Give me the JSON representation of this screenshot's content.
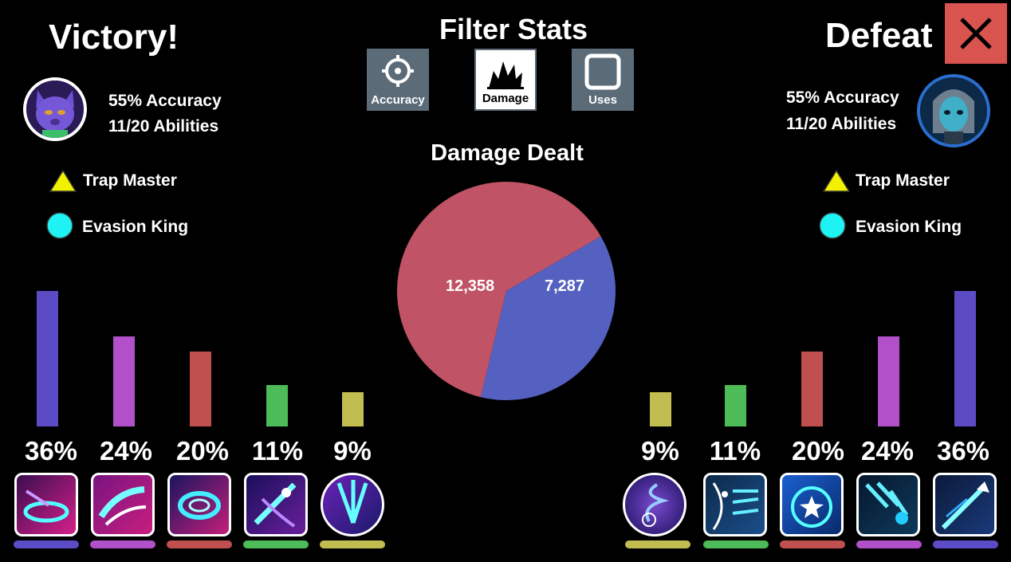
{
  "left": {
    "result": "Victory!",
    "accuracy": "55% Accuracy",
    "abilities": "11/20 Abilities",
    "badges": [
      {
        "label": "Trap Master",
        "icon": "triangle-yellow"
      },
      {
        "label": "Evasion King",
        "icon": "circle-cyan"
      }
    ],
    "shares": [
      "36%",
      "24%",
      "20%",
      "11%",
      "9%"
    ]
  },
  "right": {
    "result": "Defeat",
    "accuracy": "55% Accuracy",
    "abilities": "11/20 Abilities",
    "badges": [
      {
        "label": "Trap Master",
        "icon": "triangle-yellow"
      },
      {
        "label": "Evasion King",
        "icon": "circle-cyan"
      }
    ],
    "shares": [
      "9%",
      "11%",
      "20%",
      "24%",
      "36%"
    ]
  },
  "filter": {
    "title": "Filter Stats",
    "buttons": [
      {
        "label": "Accuracy",
        "icon": "crosshair-icon",
        "active": false
      },
      {
        "label": "Damage",
        "icon": "explosion-icon",
        "active": true
      },
      {
        "label": "Uses",
        "icon": "square-icon",
        "active": false
      }
    ]
  },
  "chart_title": "Damage Dealt",
  "chart_data": [
    {
      "type": "pie",
      "title": "Damage Dealt",
      "categories": [
        "Victory!",
        "Defeat"
      ],
      "values": [
        12358,
        7287
      ],
      "labels": [
        "12,358",
        "7,287"
      ],
      "colors": [
        "#c05365",
        "#5461c0"
      ]
    },
    {
      "type": "bar",
      "categories": [
        "ability-1",
        "ability-2",
        "ability-3",
        "ability-4",
        "ability-5"
      ],
      "values": [
        36,
        24,
        20,
        11,
        9
      ],
      "labels": [
        "36%",
        "24%",
        "20%",
        "11%",
        "9%"
      ],
      "colors": [
        "#5b4bc4",
        "#b150c8",
        "#c05050",
        "#4cbb58",
        "#c2bd50"
      ]
    },
    {
      "type": "bar",
      "categories": [
        "ability-1",
        "ability-2",
        "ability-3",
        "ability-4",
        "ability-5"
      ],
      "values": [
        9,
        11,
        20,
        24,
        36
      ],
      "labels": [
        "9%",
        "11%",
        "20%",
        "24%",
        "36%"
      ],
      "colors": [
        "#c2bd50",
        "#4cbb58",
        "#c05050",
        "#b150c8",
        "#5b4bc4"
      ]
    }
  ],
  "colors": {
    "background": "#000000",
    "close_button": "#d9534f",
    "ability_purple": "#5b4bc4",
    "ability_violet": "#b150c8",
    "ability_red": "#c05050",
    "ability_green": "#4cbb58",
    "ability_yellow": "#c2bd50"
  }
}
